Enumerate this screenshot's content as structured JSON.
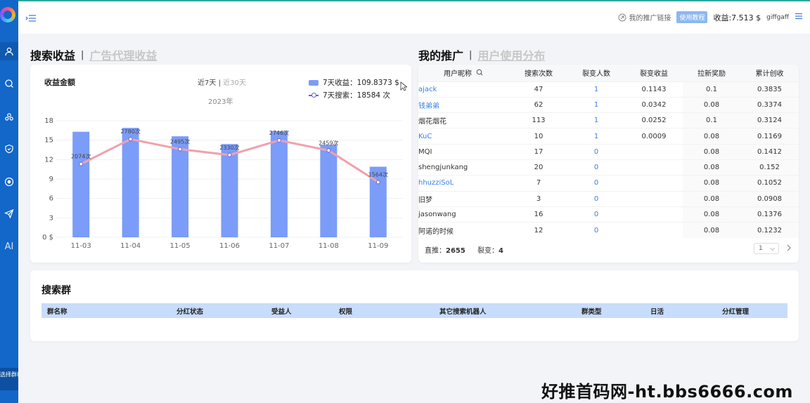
{
  "sidebar": {
    "items": [
      "user-icon",
      "search-icon",
      "team-icon",
      "shield-icon",
      "record-icon",
      "send-icon"
    ],
    "ai_label": "AI",
    "select_group_label": "选择群组 ›"
  },
  "topbar": {
    "promo_link": "我的推广链接",
    "tutorial_badge": "使用教程",
    "earnings": "收益:7.513 $",
    "username": "giffgaff"
  },
  "left_section": {
    "title": "搜索收益",
    "alt_title": "广告代理收益",
    "chart_label": "收益金额",
    "range_active": "近7天",
    "range_sep": "|",
    "range_inactive": "近30天"
  },
  "legend": {
    "bar": "7天收益：109.8373 $",
    "line": "7天搜索：18584 次"
  },
  "chart_data": {
    "type": "bar",
    "title": "2023年",
    "categories": [
      "11-03",
      "11-04",
      "11-05",
      "11-06",
      "11-07",
      "11-08",
      "11-09"
    ],
    "series": [
      {
        "name": "7天收益",
        "type": "bar",
        "values": [
          16.3,
          16.9,
          15.6,
          14.4,
          16.4,
          14.3,
          10.9
        ],
        "color": "#7b9cf8"
      },
      {
        "name": "7天搜索",
        "type": "line",
        "values": [
          2074,
          2780,
          2495,
          2330,
          2746,
          2459,
          1564
        ],
        "labels": [
          "2074次",
          "2780次",
          "2495次",
          "2330次",
          "2746次",
          "2459次",
          "1564次"
        ],
        "color": "#f0a1ad"
      }
    ],
    "yticks": [
      "0 $",
      "3",
      "6",
      "9",
      "12",
      "15",
      "18"
    ],
    "ylim": [
      0,
      18
    ],
    "line_ylim": [
      0,
      3300
    ]
  },
  "right_section": {
    "title": "我的推广",
    "alt_title": "用户使用分布"
  },
  "promo_table": {
    "headers": [
      "用户昵称",
      "搜索次数",
      "裂变人数",
      "裂变收益",
      "拉新奖励",
      "累计创收"
    ],
    "rows": [
      {
        "name": "ajack",
        "link": true,
        "searches": "47",
        "referrals": "1",
        "ref_income": "0.1143",
        "bonus": "0.1",
        "total": "0.3835"
      },
      {
        "name": "钱弟弟",
        "link": true,
        "searches": "62",
        "referrals": "1",
        "ref_income": "0.0342",
        "bonus": "0.08",
        "total": "0.3374"
      },
      {
        "name": "烟花烟花",
        "link": false,
        "searches": "113",
        "referrals": "1",
        "ref_income": "0.0252",
        "bonus": "0.1",
        "total": "0.3124"
      },
      {
        "name": "KuC",
        "link": true,
        "searches": "10",
        "referrals": "1",
        "ref_income": "0.0009",
        "bonus": "0.08",
        "total": "0.1169"
      },
      {
        "name": "MQI",
        "link": false,
        "searches": "17",
        "referrals": "0",
        "ref_income": "",
        "bonus": "0.08",
        "total": "0.1412"
      },
      {
        "name": "shengjunkang",
        "link": false,
        "searches": "20",
        "referrals": "0",
        "ref_income": "",
        "bonus": "0.08",
        "total": "0.152"
      },
      {
        "name": "hhuzziSoL",
        "link": true,
        "searches": "7",
        "referrals": "0",
        "ref_income": "",
        "bonus": "0.08",
        "total": "0.1052"
      },
      {
        "name": "旧梦",
        "link": false,
        "searches": "3",
        "referrals": "0",
        "ref_income": "",
        "bonus": "0.08",
        "total": "0.0908"
      },
      {
        "name": "jasonwang",
        "link": false,
        "searches": "16",
        "referrals": "0",
        "ref_income": "",
        "bonus": "0.08",
        "total": "0.1376"
      },
      {
        "name": "阿诺的时候",
        "link": false,
        "searches": "12",
        "referrals": "0",
        "ref_income": "",
        "bonus": "0.08",
        "total": "0.1232"
      }
    ],
    "footer_direct_label": "直推：",
    "footer_direct_value": "2655",
    "footer_split_label": "裂变：",
    "footer_split_value": "4",
    "page": "1"
  },
  "group_section": {
    "title": "搜索群",
    "headers": [
      "群名称",
      "分红状态",
      "受益人",
      "权限",
      "其它搜索机器人",
      "群类型",
      "日活",
      "分红管理"
    ]
  },
  "watermark": "好推首码网-ht.bbs6666.com"
}
